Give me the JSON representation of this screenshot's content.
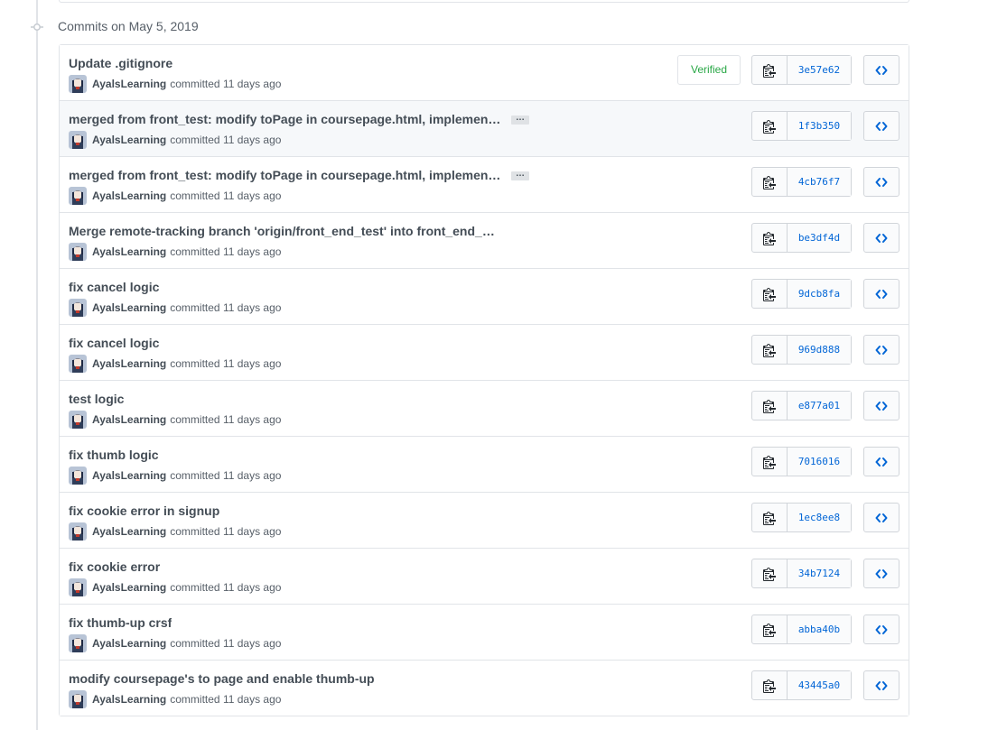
{
  "group": {
    "title": "Commits on May 5, 2019"
  },
  "commits": [
    {
      "title": "Update .gitignore",
      "author": "AyalsLearning",
      "action": "committed",
      "time": "11 days ago",
      "sha": "3e57e62",
      "verified": "Verified",
      "truncated": false
    },
    {
      "title": "merged from front_test: modify toPage in coursepage.html, implement t…",
      "author": "AyalsLearning",
      "action": "committed",
      "time": "11 days ago",
      "sha": "1f3b350",
      "verified": "",
      "truncated": true
    },
    {
      "title": "merged from front_test: modify toPage in coursepage.html, implement t…",
      "author": "AyalsLearning",
      "action": "committed",
      "time": "11 days ago",
      "sha": "4cb76f7",
      "verified": "",
      "truncated": true
    },
    {
      "title": "Merge remote-tracking branch 'origin/front_end_test' into front_end_dev",
      "author": "AyalsLearning",
      "action": "committed",
      "time": "11 days ago",
      "sha": "be3df4d",
      "verified": "",
      "truncated": false
    },
    {
      "title": "fix cancel logic",
      "author": "AyalsLearning",
      "action": "committed",
      "time": "11 days ago",
      "sha": "9dcb8fa",
      "verified": "",
      "truncated": false
    },
    {
      "title": "fix cancel logic",
      "author": "AyalsLearning",
      "action": "committed",
      "time": "11 days ago",
      "sha": "969d888",
      "verified": "",
      "truncated": false
    },
    {
      "title": "test logic",
      "author": "AyalsLearning",
      "action": "committed",
      "time": "11 days ago",
      "sha": "e877a01",
      "verified": "",
      "truncated": false
    },
    {
      "title": "fix thumb logic",
      "author": "AyalsLearning",
      "action": "committed",
      "time": "11 days ago",
      "sha": "7016016",
      "verified": "",
      "truncated": false
    },
    {
      "title": "fix cookie error in signup",
      "author": "AyalsLearning",
      "action": "committed",
      "time": "11 days ago",
      "sha": "1ec8ee8",
      "verified": "",
      "truncated": false
    },
    {
      "title": "fix cookie error",
      "author": "AyalsLearning",
      "action": "committed",
      "time": "11 days ago",
      "sha": "34b7124",
      "verified": "",
      "truncated": false
    },
    {
      "title": "fix thumb-up crsf",
      "author": "AyalsLearning",
      "action": "committed",
      "time": "11 days ago",
      "sha": "abba40b",
      "verified": "",
      "truncated": false
    },
    {
      "title": "modify coursepage's to page and enable thumb-up",
      "author": "AyalsLearning",
      "action": "committed",
      "time": "11 days ago",
      "sha": "43445a0",
      "verified": "",
      "truncated": false
    }
  ],
  "ellipsis_label": "…",
  "icons": {
    "commit_node": "git-commit-icon",
    "copy": "clippy-icon",
    "browse": "code-icon",
    "avatar": "user-avatar"
  },
  "colors": {
    "link": "#0366d6",
    "verified": "#28a745",
    "border": "#e1e4e8",
    "muted": "#586069"
  }
}
